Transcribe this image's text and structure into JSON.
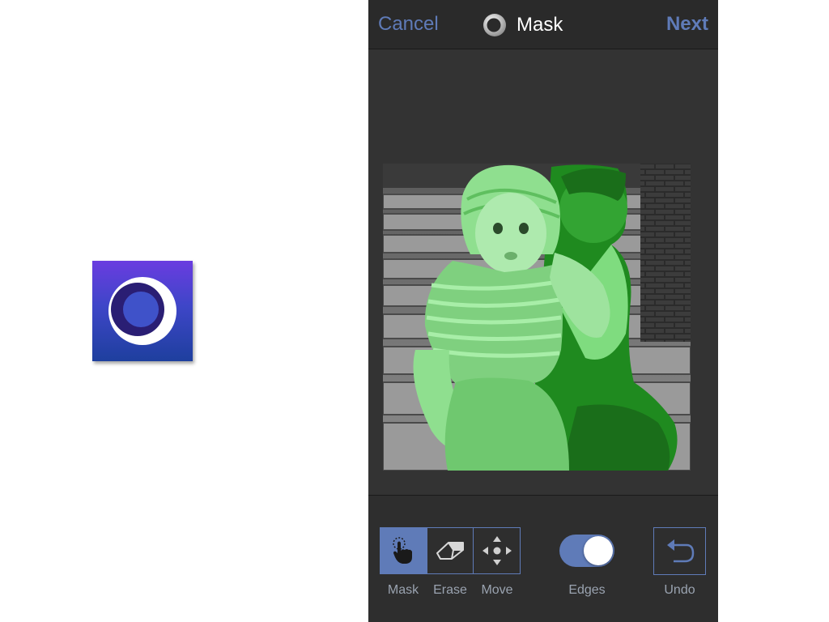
{
  "app_icon": {
    "name": "app-logo-icon"
  },
  "navbar": {
    "cancel_label": "Cancel",
    "title": "Mask",
    "title_icon": "ring-logo-icon",
    "next_label": "Next"
  },
  "photo": {
    "description_icon": "photo-canvas",
    "mask_color": "#3fbf3f"
  },
  "toolbar": {
    "mask_label": "Mask",
    "erase_label": "Erase",
    "move_label": "Move",
    "edges_label": "Edges",
    "edges_on": true,
    "undo_label": "Undo",
    "active_tool": "Mask"
  },
  "colors": {
    "accent": "#5f7bb8",
    "background": "#323232",
    "toolbar": "#2e2e2e"
  }
}
